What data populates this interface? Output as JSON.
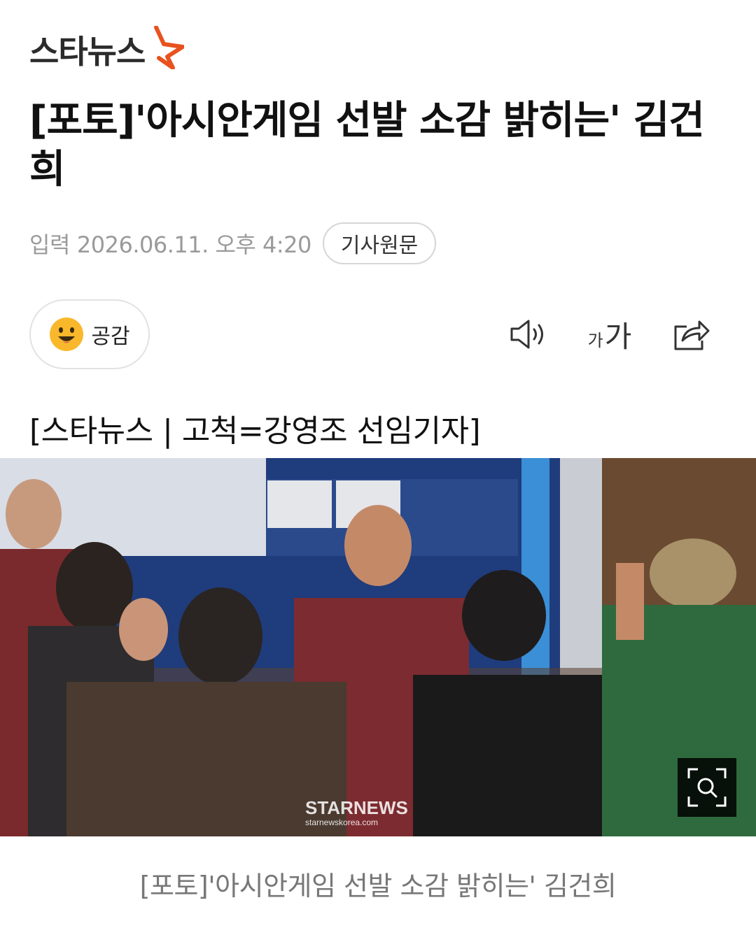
{
  "header": {
    "logo_text": "스타뉴스",
    "logo_accent_color": "#e8521e"
  },
  "article": {
    "headline": "[포토]'아시안게임 선발 소감 밝히는' 김건희",
    "meta_label": "입력",
    "published": "2026.06.11. 오후 4:20",
    "original_button": "기사원문",
    "byline": "[스타뉴스 | 고척=강영조 선임기자]",
    "caption": "[포토]'아시안게임 선발 소감 밝히는' 김건희"
  },
  "toolbar": {
    "reaction_label": "공감",
    "reaction_icon": "smiley-icon",
    "tts_icon": "speaker-icon",
    "font_small": "가",
    "font_big": "가",
    "share_icon": "share-icon"
  },
  "photo": {
    "watermark": "STARNEWS",
    "watermark_url": "starnewskorea.com",
    "zoom_icon": "zoom-icon"
  }
}
